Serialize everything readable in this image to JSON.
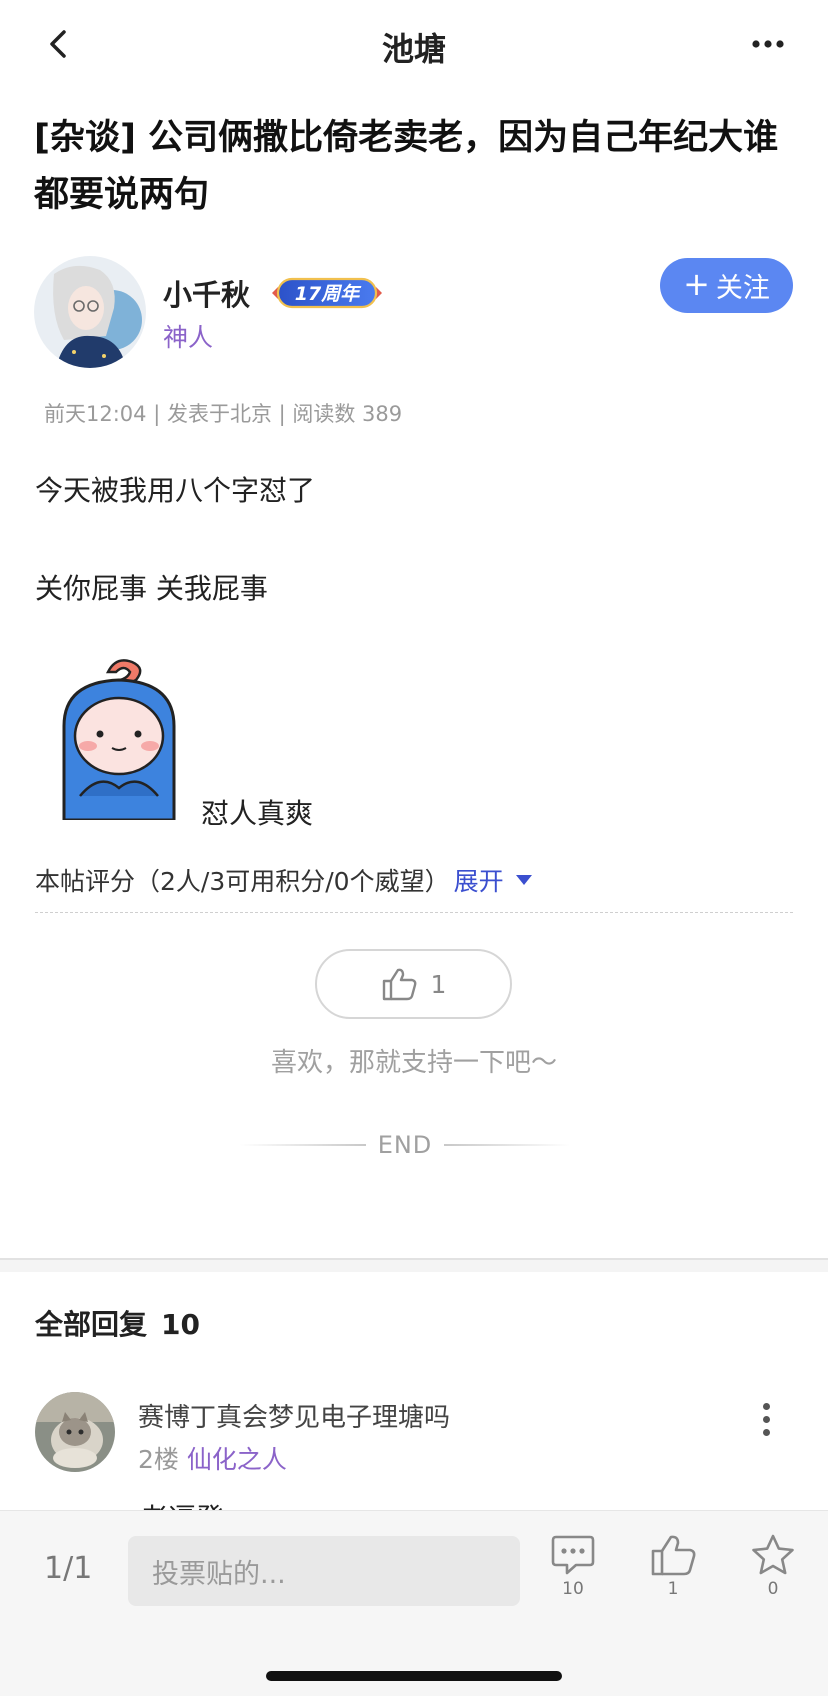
{
  "header": {
    "title": "池塘"
  },
  "post": {
    "title": "[杂谈] 公司俩撒比倚老卖老，因为自己年纪大谁都要说两句",
    "author": {
      "name": "小千秋",
      "badge": "17周年",
      "rank": "神人"
    },
    "follow_label": "关注",
    "meta": "前天12:04 | 发表于北京 | 阅读数 389",
    "content_lines": [
      "今天被我用八个字怼了",
      "关你屁事  关我屁事"
    ],
    "sticker_caption": "怼人真爽",
    "rating": {
      "summary": "本帖评分（2人/3可用积分/0个威望）",
      "expand_label": "展开"
    },
    "like_count": "1",
    "like_hint": "喜欢，那就支持一下吧～",
    "end_label": "END"
  },
  "replies": {
    "title": "全部回复",
    "count": "10",
    "items": [
      {
        "user": "赛博丁真会梦见电子理塘吗",
        "floor": "2楼",
        "rank": "仙化之人",
        "peek_text": "老逼登"
      }
    ]
  },
  "bottom_bar": {
    "page": "1/1",
    "input_placeholder": "投票贴的...",
    "comment_count": "10",
    "like_count": "1",
    "favorite_count": "0"
  },
  "colors": {
    "accent_blue": "#5b87f2",
    "rank_purple": "#8b63c9",
    "link_blue": "#3b4fcf"
  },
  "icons": [
    "back-chevron-icon",
    "more-dots-icon",
    "thumb-up-icon",
    "comment-icon",
    "star-icon",
    "triangle-down-icon"
  ]
}
